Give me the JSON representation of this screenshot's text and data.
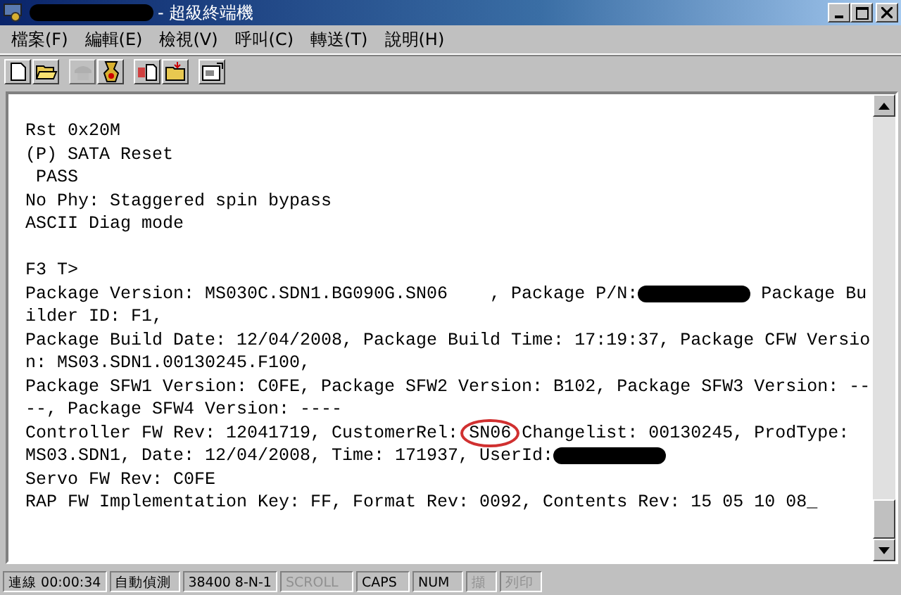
{
  "window": {
    "title": "- 超級終端機"
  },
  "menu": [
    {
      "label": "檔案(F)"
    },
    {
      "label": "編輯(E)"
    },
    {
      "label": "檢視(V)"
    },
    {
      "label": "呼叫(C)"
    },
    {
      "label": "轉送(T)"
    },
    {
      "label": "說明(H)"
    }
  ],
  "toolbar": [
    {
      "kind": "new",
      "disabled": false
    },
    {
      "kind": "open",
      "disabled": false
    },
    {
      "kind": "sep"
    },
    {
      "kind": "connect",
      "disabled": true
    },
    {
      "kind": "disconnect",
      "disabled": false
    },
    {
      "kind": "sep"
    },
    {
      "kind": "send",
      "disabled": false
    },
    {
      "kind": "receive",
      "disabled": false
    },
    {
      "kind": "sep"
    },
    {
      "kind": "properties",
      "disabled": false
    }
  ],
  "terminal": {
    "lines": [
      [
        {
          "kind": "text",
          "text": "Rst 0x20M"
        }
      ],
      [
        {
          "kind": "text",
          "text": "(P) SATA Reset"
        }
      ],
      [
        {
          "kind": "text",
          "text": " PASS"
        }
      ],
      [
        {
          "kind": "text",
          "text": "No Phy: Staggered spin bypass"
        }
      ],
      [
        {
          "kind": "text",
          "text": "ASCII Diag mode"
        }
      ],
      [
        {
          "kind": "text",
          "text": "F3 T>",
          "gap_before": true
        }
      ],
      [
        {
          "kind": "text",
          "text": "Package Version: MS030C.SDN1.BG090G.SN06    , Package P/N:"
        },
        {
          "kind": "redacted"
        },
        {
          "kind": "text",
          "text": " Package Bu"
        }
      ],
      [
        {
          "kind": "text",
          "text": "ilder ID: F1,"
        }
      ],
      [
        {
          "kind": "text",
          "text": "Package Build Date: 12/04/2008, Package Build Time: 17:19:37, Package CFW Versio"
        }
      ],
      [
        {
          "kind": "text",
          "text": "n: MS03.SDN1.00130245.F100,"
        }
      ],
      [
        {
          "kind": "text",
          "text": "Package SFW1 Version: C0FE, Package SFW2 Version: B102, Package SFW3 Version: --"
        }
      ],
      [
        {
          "kind": "text",
          "text": "--, Package SFW4 Version: ----"
        }
      ],
      [
        {
          "kind": "text",
          "text": "Controller FW Rev: 12041719, CustomerRel: "
        },
        {
          "kind": "circled",
          "text": "SN06"
        },
        {
          "kind": "text",
          "text": " Changelist: 00130245, ProdType:"
        }
      ],
      [
        {
          "kind": "text",
          "text": "MS03.SDN1, Date: 12/04/2008, Time: 171937, UserId:"
        },
        {
          "kind": "redacted"
        }
      ],
      [
        {
          "kind": "text",
          "text": "Servo FW Rev: C0FE"
        }
      ],
      [
        {
          "kind": "text",
          "text": "RAP FW Implementation Key: FF, Format Rev: 0092, Contents Rev: 15 05 10 08_"
        }
      ]
    ]
  },
  "status_bar": [
    {
      "text": "連線 00:00:34",
      "disabled": false
    },
    {
      "text": "自動偵測",
      "disabled": false
    },
    {
      "text": "38400 8-N-1",
      "disabled": false
    },
    {
      "text": "SCROLL",
      "disabled": true
    },
    {
      "text": "CAPS",
      "disabled": false
    },
    {
      "text": "NUM",
      "disabled": false
    },
    {
      "text": "擷",
      "disabled": true
    },
    {
      "text": "列印",
      "disabled": true
    }
  ]
}
